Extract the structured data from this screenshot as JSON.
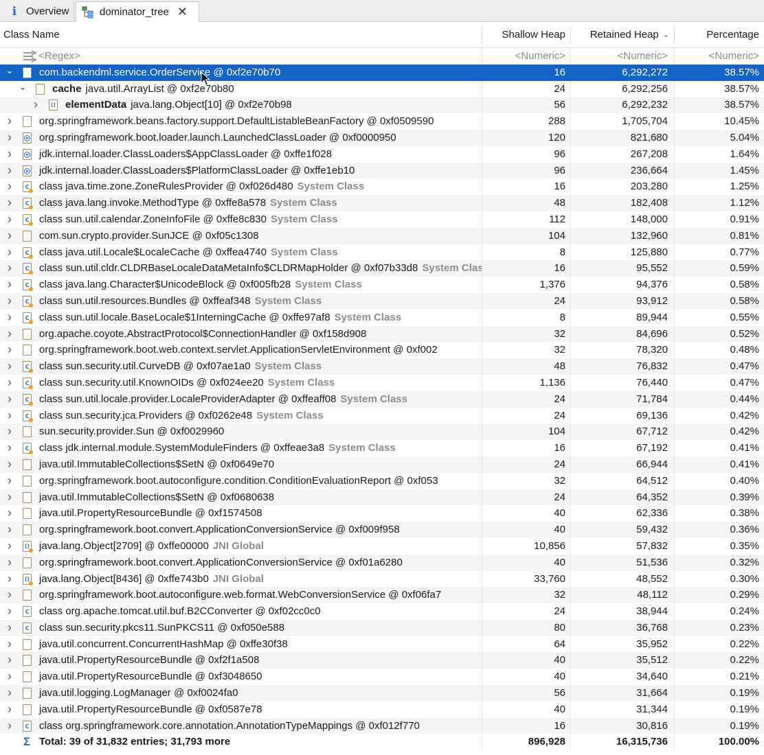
{
  "tabs": [
    {
      "label": "Overview",
      "icon": "info-icon"
    },
    {
      "label": "dominator_tree",
      "icon": "tree-icon",
      "active": true
    }
  ],
  "columns": {
    "name": "Class Name",
    "shallow": "Shallow Heap",
    "retained": "Retained Heap",
    "percentage": "Percentage"
  },
  "filter": {
    "name": "<Regex>",
    "shallow": "<Numeric>",
    "retained": "<Numeric>",
    "percentage": "<Numeric>"
  },
  "rows": [
    {
      "level": 0,
      "exp": "open",
      "icon": "obj",
      "field": "",
      "text": "com.backendml.service.OrderService @ 0xf2e70b70",
      "tag": "",
      "shallow": "16",
      "retained": "6,292,272",
      "pct": "38.57%",
      "selected": true
    },
    {
      "level": 1,
      "exp": "open",
      "icon": "obj",
      "field": "cache",
      "text": "java.util.ArrayList @ 0xf2e70b80",
      "tag": "",
      "shallow": "24",
      "retained": "6,292,256",
      "pct": "38.57%"
    },
    {
      "level": 2,
      "exp": "closed",
      "icon": "arr",
      "field": "elementData",
      "text": "java.lang.Object[10] @ 0xf2e70b98",
      "tag": "",
      "shallow": "56",
      "retained": "6,292,232",
      "pct": "38.57%"
    },
    {
      "level": 0,
      "exp": "closed",
      "icon": "obj",
      "field": "",
      "text": "org.springframework.beans.factory.support.DefaultListableBeanFactory @ 0xf0509590",
      "tag": "",
      "shallow": "288",
      "retained": "1,705,704",
      "pct": "10.45%"
    },
    {
      "level": 0,
      "exp": "closed",
      "icon": "loader",
      "field": "",
      "text": "org.springframework.boot.loader.launch.LaunchedClassLoader @ 0xf0000950",
      "tag": "",
      "shallow": "120",
      "retained": "821,680",
      "pct": "5.04%"
    },
    {
      "level": 0,
      "exp": "closed",
      "icon": "loader",
      "field": "",
      "text": "jdk.internal.loader.ClassLoaders$AppClassLoader @ 0xffe1f028",
      "tag": "",
      "shallow": "96",
      "retained": "267,208",
      "pct": "1.64%"
    },
    {
      "level": 0,
      "exp": "closed",
      "icon": "loader",
      "field": "",
      "text": "jdk.internal.loader.ClassLoaders$PlatformClassLoader @ 0xffe1eb10",
      "tag": "",
      "shallow": "96",
      "retained": "236,664",
      "pct": "1.45%"
    },
    {
      "level": 0,
      "exp": "closed",
      "icon": "clsys",
      "field": "",
      "text": "class java.time.zone.ZoneRulesProvider @ 0xf026d480",
      "tag": "System Class",
      "shallow": "16",
      "retained": "203,280",
      "pct": "1.25%"
    },
    {
      "level": 0,
      "exp": "closed",
      "icon": "clsys",
      "field": "",
      "text": "class java.lang.invoke.MethodType @ 0xffe8a578",
      "tag": "System Class",
      "shallow": "48",
      "retained": "182,408",
      "pct": "1.12%"
    },
    {
      "level": 0,
      "exp": "closed",
      "icon": "clsys",
      "field": "",
      "text": "class sun.util.calendar.ZoneInfoFile @ 0xffe8c830",
      "tag": "System Class",
      "shallow": "112",
      "retained": "148,000",
      "pct": "0.91%"
    },
    {
      "level": 0,
      "exp": "closed",
      "icon": "obj",
      "field": "",
      "text": "com.sun.crypto.provider.SunJCE @ 0xf05c1308",
      "tag": "",
      "shallow": "104",
      "retained": "132,960",
      "pct": "0.81%"
    },
    {
      "level": 0,
      "exp": "closed",
      "icon": "clsys",
      "field": "",
      "text": "class java.util.Locale$LocaleCache @ 0xffea4740",
      "tag": "System Class",
      "shallow": "8",
      "retained": "125,880",
      "pct": "0.77%"
    },
    {
      "level": 0,
      "exp": "closed",
      "icon": "clsys",
      "field": "",
      "text": "class sun.util.cldr.CLDRBaseLocaleDataMetaInfo$CLDRMapHolder @ 0xf07b33d8",
      "tag": "System Class",
      "shallow": "16",
      "retained": "95,552",
      "pct": "0.59%"
    },
    {
      "level": 0,
      "exp": "closed",
      "icon": "clsys",
      "field": "",
      "text": "class java.lang.Character$UnicodeBlock @ 0xf005fb28",
      "tag": "System Class",
      "shallow": "1,376",
      "retained": "94,376",
      "pct": "0.58%"
    },
    {
      "level": 0,
      "exp": "closed",
      "icon": "clsys",
      "field": "",
      "text": "class sun.util.resources.Bundles @ 0xffeaf348",
      "tag": "System Class",
      "shallow": "24",
      "retained": "93,912",
      "pct": "0.58%"
    },
    {
      "level": 0,
      "exp": "closed",
      "icon": "clsys",
      "field": "",
      "text": "class sun.util.locale.BaseLocale$1InterningCache @ 0xffe97af8",
      "tag": "System Class",
      "shallow": "8",
      "retained": "89,944",
      "pct": "0.55%"
    },
    {
      "level": 0,
      "exp": "closed",
      "icon": "obj",
      "field": "",
      "text": "org.apache.coyote.AbstractProtocol$ConnectionHandler @ 0xf158d908",
      "tag": "",
      "shallow": "32",
      "retained": "84,696",
      "pct": "0.52%"
    },
    {
      "level": 0,
      "exp": "closed",
      "icon": "obj",
      "field": "",
      "text": "org.springframework.boot.web.context.servlet.ApplicationServletEnvironment @ 0xf002",
      "tag": "",
      "shallow": "32",
      "retained": "78,320",
      "pct": "0.48%"
    },
    {
      "level": 0,
      "exp": "closed",
      "icon": "clsys",
      "field": "",
      "text": "class sun.security.util.CurveDB @ 0xf07ae1a0",
      "tag": "System Class",
      "shallow": "48",
      "retained": "76,832",
      "pct": "0.47%"
    },
    {
      "level": 0,
      "exp": "closed",
      "icon": "clsys",
      "field": "",
      "text": "class sun.security.util.KnownOIDs @ 0xf024ee20",
      "tag": "System Class",
      "shallow": "1,136",
      "retained": "76,440",
      "pct": "0.47%"
    },
    {
      "level": 0,
      "exp": "closed",
      "icon": "clsys",
      "field": "",
      "text": "class sun.util.locale.provider.LocaleProviderAdapter @ 0xffeaff08",
      "tag": "System Class",
      "shallow": "24",
      "retained": "71,784",
      "pct": "0.44%"
    },
    {
      "level": 0,
      "exp": "closed",
      "icon": "clsys",
      "field": "",
      "text": "class sun.security.jca.Providers @ 0xf0262e48",
      "tag": "System Class",
      "shallow": "24",
      "retained": "69,136",
      "pct": "0.42%"
    },
    {
      "level": 0,
      "exp": "closed",
      "icon": "obj",
      "field": "",
      "text": "sun.security.provider.Sun @ 0xf0029960",
      "tag": "",
      "shallow": "104",
      "retained": "67,712",
      "pct": "0.42%"
    },
    {
      "level": 0,
      "exp": "closed",
      "icon": "clsys",
      "field": "",
      "text": "class jdk.internal.module.SystemModuleFinders @ 0xffeae3a8",
      "tag": "System Class",
      "shallow": "16",
      "retained": "67,192",
      "pct": "0.41%"
    },
    {
      "level": 0,
      "exp": "closed",
      "icon": "obj",
      "field": "",
      "text": "java.util.ImmutableCollections$SetN @ 0xf0649e70",
      "tag": "",
      "shallow": "24",
      "retained": "66,944",
      "pct": "0.41%"
    },
    {
      "level": 0,
      "exp": "closed",
      "icon": "obj",
      "field": "",
      "text": "org.springframework.boot.autoconfigure.condition.ConditionEvaluationReport @ 0xf053",
      "tag": "",
      "shallow": "32",
      "retained": "64,512",
      "pct": "0.40%"
    },
    {
      "level": 0,
      "exp": "closed",
      "icon": "obj",
      "field": "",
      "text": "java.util.ImmutableCollections$SetN @ 0xf0680638",
      "tag": "",
      "shallow": "24",
      "retained": "64,352",
      "pct": "0.39%"
    },
    {
      "level": 0,
      "exp": "closed",
      "icon": "obj",
      "field": "",
      "text": "java.util.PropertyResourceBundle @ 0xf1574508",
      "tag": "",
      "shallow": "40",
      "retained": "62,336",
      "pct": "0.38%"
    },
    {
      "level": 0,
      "exp": "closed",
      "icon": "obj",
      "field": "",
      "text": "org.springframework.boot.convert.ApplicationConversionService @ 0xf009f958",
      "tag": "",
      "shallow": "40",
      "retained": "59,432",
      "pct": "0.36%"
    },
    {
      "level": 0,
      "exp": "closed",
      "icon": "arrjni",
      "field": "",
      "text": "java.lang.Object[2709] @ 0xffe00000",
      "tag": "JNI Global",
      "shallow": "10,856",
      "retained": "57,832",
      "pct": "0.35%"
    },
    {
      "level": 0,
      "exp": "closed",
      "icon": "obj",
      "field": "",
      "text": "org.springframework.boot.convert.ApplicationConversionService @ 0xf01a6280",
      "tag": "",
      "shallow": "40",
      "retained": "51,536",
      "pct": "0.32%"
    },
    {
      "level": 0,
      "exp": "closed",
      "icon": "arrjni",
      "field": "",
      "text": "java.lang.Object[8436] @ 0xffe743b0",
      "tag": "JNI Global",
      "shallow": "33,760",
      "retained": "48,552",
      "pct": "0.30%"
    },
    {
      "level": 0,
      "exp": "closed",
      "icon": "obj",
      "field": "",
      "text": "org.springframework.boot.autoconfigure.web.format.WebConversionService @ 0xf06fa7",
      "tag": "",
      "shallow": "32",
      "retained": "48,112",
      "pct": "0.29%"
    },
    {
      "level": 0,
      "exp": "closed",
      "icon": "cls",
      "field": "",
      "text": "class org.apache.tomcat.util.buf.B2CConverter @ 0xf02cc0c0",
      "tag": "",
      "shallow": "24",
      "retained": "38,944",
      "pct": "0.24%"
    },
    {
      "level": 0,
      "exp": "closed",
      "icon": "cls",
      "field": "",
      "text": "class sun.security.pkcs11.SunPKCS11 @ 0xf050e588",
      "tag": "",
      "shallow": "80",
      "retained": "36,768",
      "pct": "0.23%"
    },
    {
      "level": 0,
      "exp": "closed",
      "icon": "obj",
      "field": "",
      "text": "java.util.concurrent.ConcurrentHashMap @ 0xffe30f38",
      "tag": "",
      "shallow": "64",
      "retained": "35,952",
      "pct": "0.22%"
    },
    {
      "level": 0,
      "exp": "closed",
      "icon": "obj",
      "field": "",
      "text": "java.util.PropertyResourceBundle @ 0xf2f1a508",
      "tag": "",
      "shallow": "40",
      "retained": "35,512",
      "pct": "0.22%"
    },
    {
      "level": 0,
      "exp": "closed",
      "icon": "obj",
      "field": "",
      "text": "java.util.PropertyResourceBundle @ 0xf3048650",
      "tag": "",
      "shallow": "40",
      "retained": "34,640",
      "pct": "0.21%"
    },
    {
      "level": 0,
      "exp": "closed",
      "icon": "obj",
      "field": "",
      "text": "java.util.logging.LogManager @ 0xf0024fa0",
      "tag": "",
      "shallow": "56",
      "retained": "31,664",
      "pct": "0.19%"
    },
    {
      "level": 0,
      "exp": "closed",
      "icon": "obj",
      "field": "",
      "text": "java.util.PropertyResourceBundle @ 0xf0587e78",
      "tag": "",
      "shallow": "40",
      "retained": "31,344",
      "pct": "0.19%"
    },
    {
      "level": 0,
      "exp": "closed",
      "icon": "cls",
      "field": "",
      "text": "class org.springframework.core.annotation.AnnotationTypeMappings @ 0xf012f770",
      "tag": "",
      "shallow": "16",
      "retained": "30,816",
      "pct": "0.19%"
    }
  ],
  "total": {
    "label": "Total: 39 of 31,832 entries; 31,793 more",
    "shallow": "896,928",
    "retained": "16,315,736",
    "pct": "100.00%"
  },
  "colors": {
    "selection": "#1464c8",
    "system_tag": "#8c8c8c",
    "accent": "#2b6cc4"
  }
}
